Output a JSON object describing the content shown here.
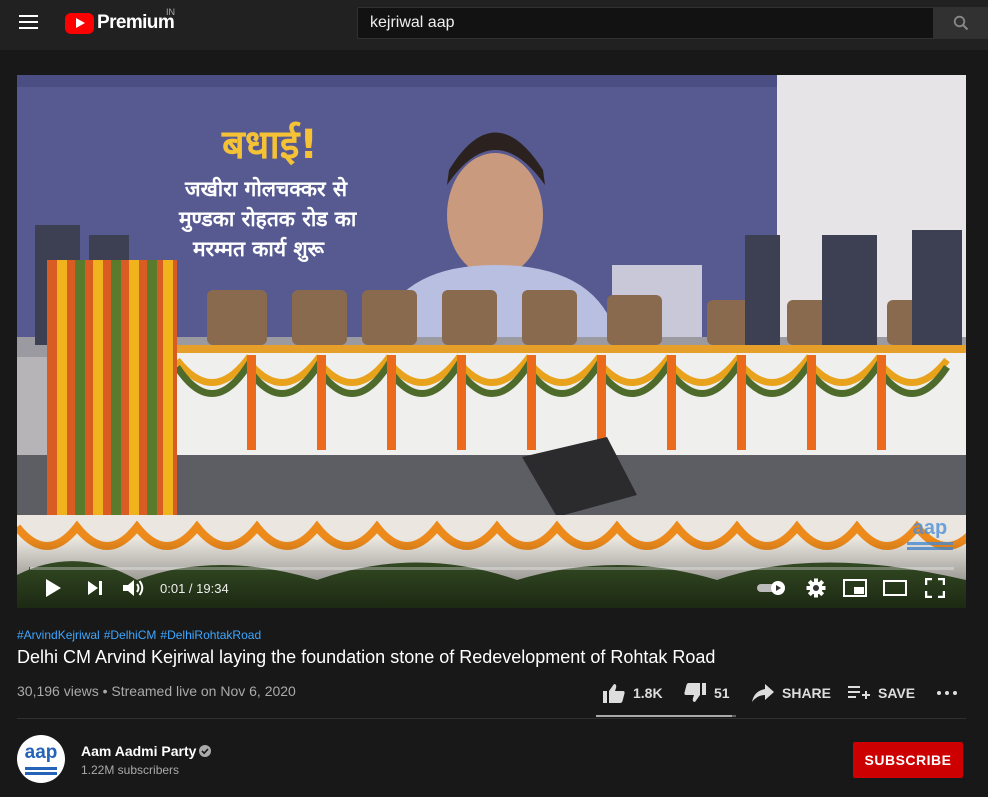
{
  "header": {
    "logo_text": "Premium",
    "country_code": "IN",
    "search_value": "kejriwal aap"
  },
  "player": {
    "time_display": "0:01 / 19:34",
    "progress_percent": 0.1,
    "banner_heading": "बधाई!",
    "banner_lines": [
      "जखीरा गोलचक्कर से",
      "मुण्डका रोहतक रोड का",
      "मरम्मत कार्य शुरू"
    ],
    "watermark": "aap"
  },
  "video": {
    "hashtags": [
      "#ArvindKejriwal",
      "#DelhiCM",
      "#DelhiRohtakRoad"
    ],
    "title": "Delhi CM Arvind Kejriwal laying the foundation stone of Redevelopment of Rohtak Road",
    "views": "30,196 views",
    "separator": " • ",
    "streamed": "Streamed live on Nov 6, 2020",
    "likes": "1.8K",
    "dislikes": "51",
    "like_ratio_percent": 97,
    "share_label": "SHARE",
    "save_label": "SAVE"
  },
  "channel": {
    "name": "Aam Aadmi Party",
    "subscribers": "1.22M subscribers",
    "subscribe_label": "SUBSCRIBE",
    "avatar_text": "aap"
  },
  "colors": {
    "accent_red": "#cc0000",
    "link_blue": "#3ea6ff",
    "background": "#181818"
  },
  "icons": [
    "menu-icon",
    "youtube-logo-icon",
    "search-icon",
    "play-icon",
    "next-icon",
    "volume-icon",
    "autoplay-toggle-icon",
    "settings-icon",
    "miniplayer-icon",
    "theater-icon",
    "fullscreen-icon",
    "thumb-up-icon",
    "thumb-down-icon",
    "share-icon",
    "save-icon",
    "more-icon",
    "verified-icon"
  ]
}
